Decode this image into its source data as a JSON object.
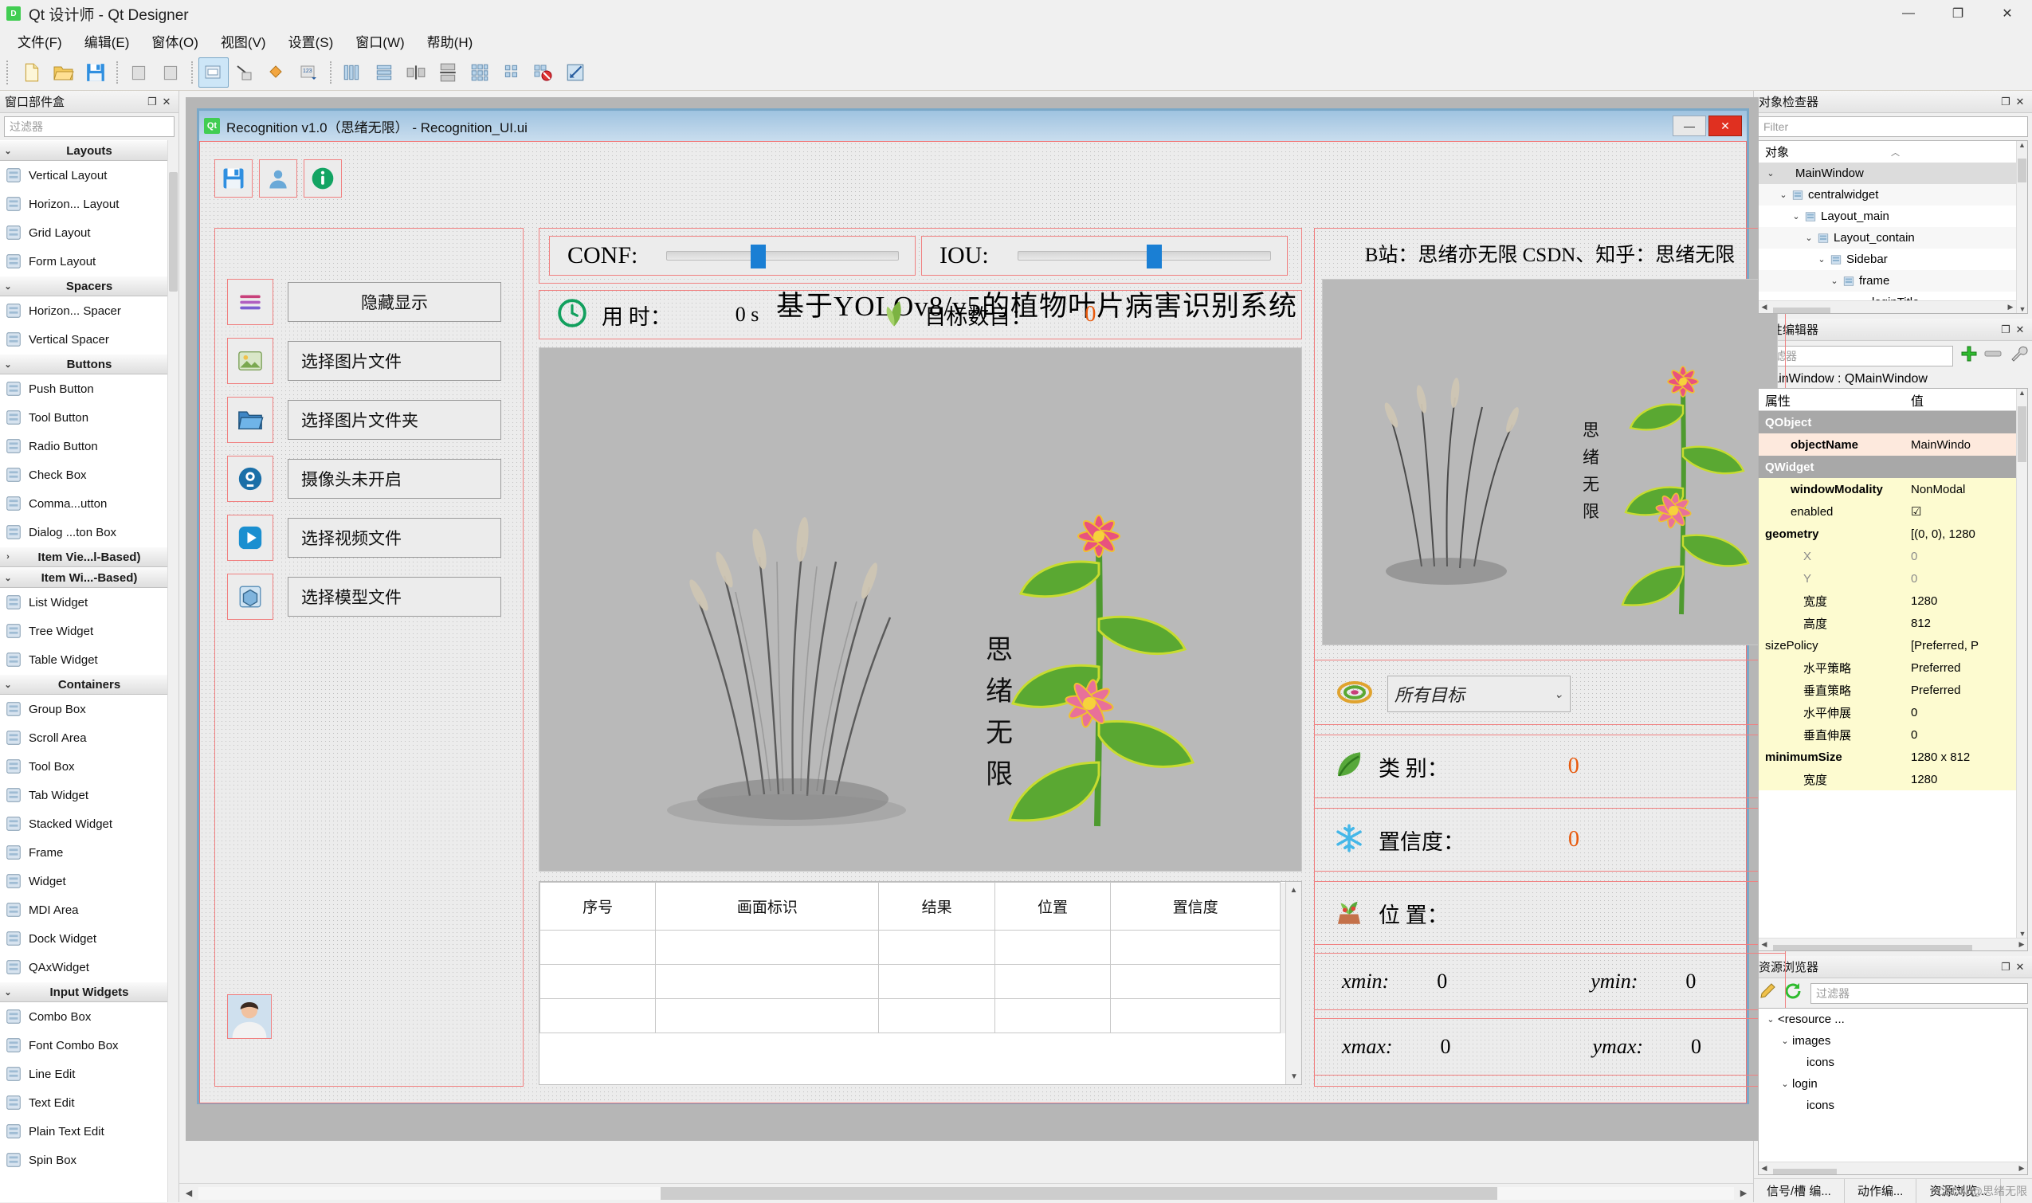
{
  "window": {
    "title": "Qt 设计师 - Qt Designer",
    "logo_text": "D",
    "controls": {
      "minimize": "—",
      "maximize": "❐",
      "close": "✕"
    }
  },
  "menubar": {
    "items": [
      {
        "label": "文件(F)",
        "name": "menu-file"
      },
      {
        "label": "编辑(E)",
        "name": "menu-edit"
      },
      {
        "label": "窗体(O)",
        "name": "menu-form"
      },
      {
        "label": "视图(V)",
        "name": "menu-view"
      },
      {
        "label": "设置(S)",
        "name": "menu-settings"
      },
      {
        "label": "窗口(W)",
        "name": "menu-window"
      },
      {
        "label": "帮助(H)",
        "name": "menu-help"
      }
    ]
  },
  "widget_box": {
    "title": "窗口部件盒",
    "filter_placeholder": "过滤器",
    "groups": [
      {
        "name": "Layouts",
        "expanded": true,
        "items": [
          {
            "label": "Vertical Layout",
            "icon": "vertical-layout-icon"
          },
          {
            "label": "Horizon... Layout",
            "icon": "horizontal-layout-icon"
          },
          {
            "label": "Grid Layout",
            "icon": "grid-layout-icon"
          },
          {
            "label": "Form Layout",
            "icon": "form-layout-icon"
          }
        ]
      },
      {
        "name": "Spacers",
        "expanded": true,
        "items": [
          {
            "label": "Horizon... Spacer",
            "icon": "horizontal-spacer-icon"
          },
          {
            "label": "Vertical Spacer",
            "icon": "vertical-spacer-icon"
          }
        ]
      },
      {
        "name": "Buttons",
        "expanded": true,
        "items": [
          {
            "label": "Push Button",
            "icon": "push-button-icon"
          },
          {
            "label": "Tool Button",
            "icon": "tool-button-icon"
          },
          {
            "label": "Radio Button",
            "icon": "radio-button-icon"
          },
          {
            "label": "Check Box",
            "icon": "check-box-icon"
          },
          {
            "label": "Comma...utton",
            "icon": "command-link-icon"
          },
          {
            "label": "Dialog ...ton Box",
            "icon": "dialog-button-box-icon"
          }
        ]
      },
      {
        "name": "Item Vie...l-Based)",
        "expanded": false,
        "items": []
      },
      {
        "name": "Item Wi...-Based)",
        "expanded": true,
        "items": [
          {
            "label": "List Widget",
            "icon": "list-widget-icon"
          },
          {
            "label": "Tree Widget",
            "icon": "tree-widget-icon"
          },
          {
            "label": "Table Widget",
            "icon": "table-widget-icon"
          }
        ]
      },
      {
        "name": "Containers",
        "expanded": true,
        "items": [
          {
            "label": "Group Box",
            "icon": "group-box-icon"
          },
          {
            "label": "Scroll Area",
            "icon": "scroll-area-icon"
          },
          {
            "label": "Tool Box",
            "icon": "tool-box-icon"
          },
          {
            "label": "Tab Widget",
            "icon": "tab-widget-icon"
          },
          {
            "label": "Stacked Widget",
            "icon": "stacked-widget-icon"
          },
          {
            "label": "Frame",
            "icon": "frame-icon"
          },
          {
            "label": "Widget",
            "icon": "widget-icon"
          },
          {
            "label": "MDI Area",
            "icon": "mdi-area-icon"
          },
          {
            "label": "Dock Widget",
            "icon": "dock-widget-icon"
          },
          {
            "label": "QAxWidget",
            "icon": "qax-widget-icon"
          }
        ]
      },
      {
        "name": "Input Widgets",
        "expanded": true,
        "items": [
          {
            "label": "Combo Box",
            "icon": "combo-box-icon"
          },
          {
            "label": "Font Combo Box",
            "icon": "font-combo-box-icon"
          },
          {
            "label": "Line Edit",
            "icon": "line-edit-icon"
          },
          {
            "label": "Text Edit",
            "icon": "text-edit-icon"
          },
          {
            "label": "Plain Text Edit",
            "icon": "plain-text-edit-icon"
          },
          {
            "label": "Spin Box",
            "icon": "spin-box-icon"
          }
        ]
      }
    ]
  },
  "form": {
    "window_title": "Recognition v1.0（思绪无限） - Recognition_UI.ui",
    "qt_badge": "Qt",
    "buttons": {
      "minimize": "—",
      "close": "✕"
    },
    "app_title": "基于YOLOv8/v5的植物叶片病害识别系统",
    "top_icons": [
      {
        "name": "save-icon",
        "glyph": "save"
      },
      {
        "name": "user-icon",
        "glyph": "user"
      },
      {
        "name": "info-icon",
        "glyph": "info"
      }
    ],
    "sidebar": [
      {
        "icon": "menu-icon",
        "label": "隐藏显示"
      },
      {
        "icon": "image-file-icon",
        "label": "选择图片文件"
      },
      {
        "icon": "folder-icon",
        "label": "选择图片文件夹"
      },
      {
        "icon": "camera-icon",
        "label": "摄像头未开启"
      },
      {
        "icon": "play-icon",
        "label": "选择视频文件"
      },
      {
        "icon": "model-icon",
        "label": "选择模型文件"
      }
    ],
    "conf": {
      "label": "CONF:",
      "slider_pct": 36
    },
    "iou": {
      "label": "IOU:",
      "slider_pct": 51
    },
    "time": {
      "icon": "clock-icon",
      "label": "用 时：",
      "value": "0 s"
    },
    "count": {
      "icon": "leaf-icon",
      "label": "目标数目：",
      "value": "0"
    },
    "results_table": {
      "headers": [
        "序号",
        "画面标识",
        "结果",
        "位置",
        "置信度"
      ],
      "rows": [
        [
          "",
          "",
          "",
          "",
          ""
        ],
        [
          "",
          "",
          "",
          "",
          ""
        ],
        [
          "",
          "",
          "",
          "",
          ""
        ]
      ]
    },
    "right_panel": {
      "credit": "B站：思绪亦无限 CSDN、知乎：思绪无限",
      "image_caption": "思绪无限",
      "target_select": {
        "icon": "target-icon",
        "value": "所有目标"
      },
      "fields": [
        {
          "icon": "leaf-green-icon",
          "label": "类 别：",
          "value": "0"
        },
        {
          "icon": "snow-icon",
          "label": "置信度：",
          "value": "0"
        },
        {
          "icon": "plant-icon",
          "label": "位 置：",
          "value": ""
        }
      ],
      "coords": [
        {
          "label": "xmin:",
          "value": "0",
          "label2": "ymin:",
          "value2": "0"
        },
        {
          "label": "xmax:",
          "value": "0",
          "label2": "ymax:",
          "value2": "0"
        }
      ]
    }
  },
  "object_inspector": {
    "title": "对象检查器",
    "filter_placeholder": "Filter",
    "column_header": "对象",
    "nodes": [
      {
        "depth": 0,
        "label": "MainWindow",
        "caret": "⌄",
        "icon": "",
        "selected": true
      },
      {
        "depth": 1,
        "label": "centralwidget",
        "caret": "⌄",
        "icon": "hlayout-icon"
      },
      {
        "depth": 2,
        "label": "Layout_main",
        "caret": "⌄",
        "icon": "vlayout-icon"
      },
      {
        "depth": 3,
        "label": "Layout_contain",
        "caret": "⌄",
        "icon": "hlayout-icon"
      },
      {
        "depth": 4,
        "label": "Sidebar",
        "caret": "⌄",
        "icon": "vlayout-icon"
      },
      {
        "depth": 5,
        "label": "frame",
        "caret": "⌄",
        "icon": "frame-nolayout-icon"
      },
      {
        "depth": 6,
        "label": "loginTitle",
        "caret": "",
        "icon": ""
      }
    ]
  },
  "property_editor": {
    "title": "属性编辑器",
    "filter_placeholder": "过滤器",
    "object_line": "MainWindow : QMainWindow",
    "col_property": "属性",
    "col_value": "值",
    "toolbar_icons": [
      "plus-icon",
      "minus-icon",
      "wrench-icon"
    ],
    "rows": [
      {
        "type": "group",
        "key": "QObject",
        "value": "",
        "caret": "⌄"
      },
      {
        "type": "pink",
        "key": "objectName",
        "value": "MainWindo",
        "bold": true,
        "indent": 1
      },
      {
        "type": "group",
        "key": "QWidget",
        "value": "",
        "caret": "⌄"
      },
      {
        "type": "yel",
        "key": "windowModality",
        "value": "NonModal",
        "bold": true,
        "indent": 1
      },
      {
        "type": "yel",
        "key": "enabled",
        "value": "☑",
        "indent": 1
      },
      {
        "type": "yel",
        "key": "geometry",
        "value": "[(0, 0), 1280",
        "bold": true,
        "caret": "⌄"
      },
      {
        "type": "yel",
        "key": "X",
        "value": "0",
        "indent": 2,
        "grey": true
      },
      {
        "type": "yel",
        "key": "Y",
        "value": "0",
        "indent": 2,
        "grey": true
      },
      {
        "type": "yel",
        "key": "宽度",
        "value": "1280",
        "indent": 2
      },
      {
        "type": "yel",
        "key": "高度",
        "value": "812",
        "indent": 2
      },
      {
        "type": "yel",
        "key": "sizePolicy",
        "value": "[Preferred, P",
        "caret": "⌄"
      },
      {
        "type": "yel",
        "key": "水平策略",
        "value": "Preferred",
        "indent": 2
      },
      {
        "type": "yel",
        "key": "垂直策略",
        "value": "Preferred",
        "indent": 2
      },
      {
        "type": "yel",
        "key": "水平伸展",
        "value": "0",
        "indent": 2
      },
      {
        "type": "yel",
        "key": "垂直伸展",
        "value": "0",
        "indent": 2
      },
      {
        "type": "yel",
        "key": "minimumSize",
        "value": "1280 x 812",
        "bold": true,
        "caret": "⌄"
      },
      {
        "type": "yel",
        "key": "宽度",
        "value": "1280",
        "indent": 2
      }
    ]
  },
  "resource_browser": {
    "title": "资源浏览器",
    "filter_placeholder": "过滤器",
    "toolbar_icons": [
      "pencil-icon",
      "refresh-icon"
    ],
    "nodes": [
      {
        "depth": 0,
        "label": "<resource ...",
        "caret": "⌄"
      },
      {
        "depth": 1,
        "label": "images",
        "caret": "⌄"
      },
      {
        "depth": 2,
        "label": "icons",
        "caret": ""
      },
      {
        "depth": 1,
        "label": "login",
        "caret": "⌄"
      },
      {
        "depth": 2,
        "label": "icons",
        "caret": ""
      }
    ]
  },
  "statusbar": {
    "tabs": [
      {
        "label": "信号/槽 编..."
      },
      {
        "label": "动作编..."
      },
      {
        "label": "资源浏览..."
      }
    ]
  },
  "watermark": "CSDN @思绪无限",
  "colors": {
    "accent_blue": "#1a7fd4",
    "layout_red": "#f08080",
    "value_orange": "#e8590c",
    "green": "#41cd52"
  }
}
